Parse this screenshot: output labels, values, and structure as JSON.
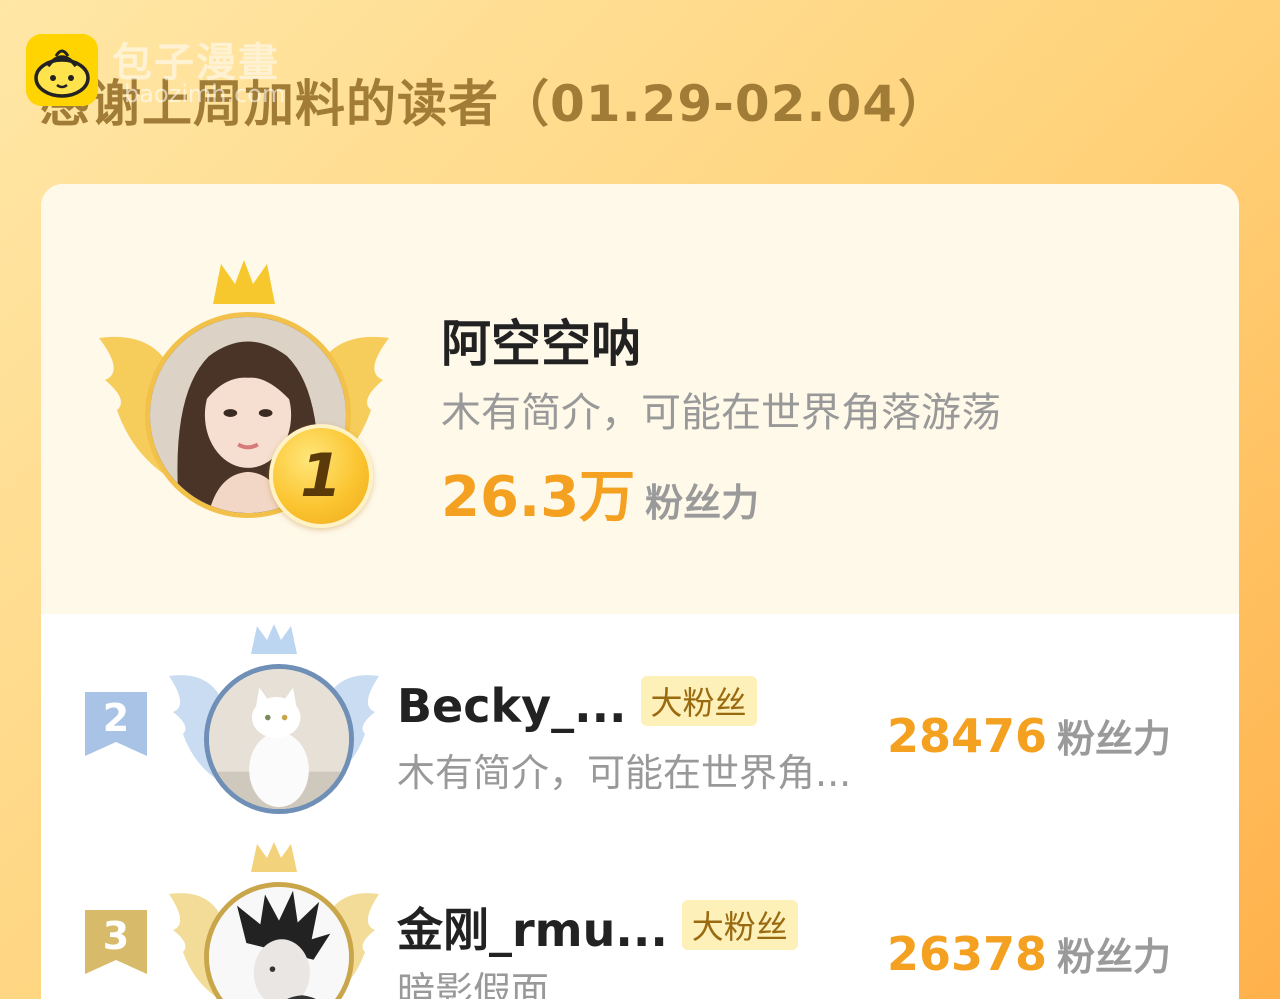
{
  "watermark": {
    "brand": "包子漫畫",
    "url": "baozimh.com"
  },
  "heading": "感谢上周加料的读者（01.29-02.04）",
  "top_reader": {
    "rank": "1",
    "name": "阿空空呐",
    "bio": "木有简介，可能在世界角落游荡",
    "fan_power": "26.3万",
    "fan_power_unit": "粉丝力"
  },
  "readers": [
    {
      "rank": "2",
      "name": "Becky_...",
      "tag": "大粉丝",
      "bio": "木有简介，可能在世界角...",
      "fan_power": "28476",
      "fan_power_unit": "粉丝力"
    },
    {
      "rank": "3",
      "name": "金刚_rmu...",
      "tag": "大粉丝",
      "bio": "暗影假面",
      "fan_power": "26378",
      "fan_power_unit": "粉丝力"
    }
  ],
  "colors": {
    "accent_orange": "#f4a020",
    "heading": "#a07c36",
    "gold": "#f2c14a",
    "silver_blue": "#6f8fb6",
    "bronze": "#c9a64a"
  }
}
